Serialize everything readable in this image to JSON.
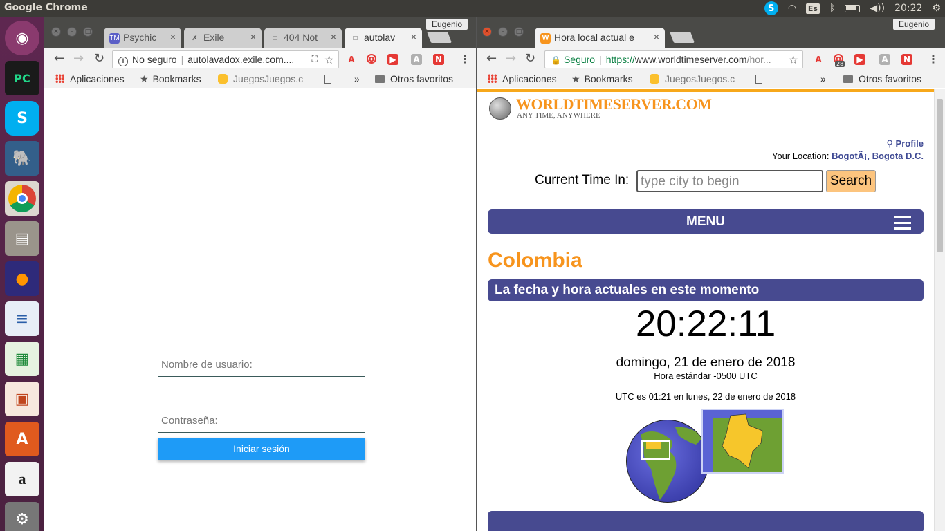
{
  "top_panel": {
    "app_title": "Google Chrome",
    "keyboard": "Es",
    "clock": "20:22"
  },
  "launcher": {
    "items": [
      "ubuntu-dash",
      "pycharm",
      "skype",
      "pgadmin",
      "chrome",
      "files",
      "firefox",
      "libreoffice-writer",
      "libreoffice-calc",
      "libreoffice-impress",
      "ubuntu-software",
      "amazon",
      "system-settings"
    ]
  },
  "left_window": {
    "profile": "Eugenio",
    "tabs": [
      {
        "label": "Psychic",
        "favicon": "TM"
      },
      {
        "label": "Exile",
        "favicon": "✗"
      },
      {
        "label": "404 Not",
        "favicon": "□"
      },
      {
        "label": "autolav",
        "favicon": "□"
      }
    ],
    "omnibox": {
      "security": "No seguro",
      "url": "autolavadox.exile.com...."
    },
    "bookmarks": {
      "apps": "Aplicaciones",
      "bookmarks": "Bookmarks",
      "juegos": "JuegosJuegos.c",
      "more": "»",
      "others": "Otros favoritos"
    },
    "login": {
      "username_placeholder": "Nombre de usuario:",
      "password_placeholder": "Contraseña:",
      "submit_label": "Iniciar sesión"
    }
  },
  "right_window": {
    "profile": "Eugenio",
    "tabs": [
      {
        "label": "Hora local actual e",
        "favicon": "W"
      }
    ],
    "omnibox": {
      "security": "Seguro",
      "url_scheme": "https://",
      "url_host": "www.worldtimeserver.com",
      "url_path": "/hor..."
    },
    "ext_badge": "28",
    "bookmarks": {
      "apps": "Aplicaciones",
      "bookmarks": "Bookmarks",
      "juegos": "JuegosJuegos.c",
      "more": "»",
      "others": "Otros favoritos"
    },
    "site": {
      "logo": "WORLDTIMESERVER.COM",
      "tagline": "ANY TIME, ANYWHERE",
      "profile_link": "Profile",
      "location_label": "Your Location:",
      "location_value": "BogotÃ¡, Bogota D.C.",
      "current_time_label": "Current Time In:",
      "search_placeholder": "type city to begin",
      "search_button": "Search",
      "menu_label": "MENU",
      "country": "Colombia",
      "section_title": "La fecha y hora actuales en este momento",
      "time": "20:22:11",
      "date": "domingo, 21 de enero de 2018",
      "standard": "Hora estándar -0500 UTC",
      "utc_note": "UTC es 01:21 en lunes, 22 de enero de 2018"
    }
  },
  "colors": {
    "accent_orange": "#f7941d",
    "menu_blue": "#474a90",
    "login_button": "#1e9bf7",
    "launcher_bg": "#5e2750"
  }
}
